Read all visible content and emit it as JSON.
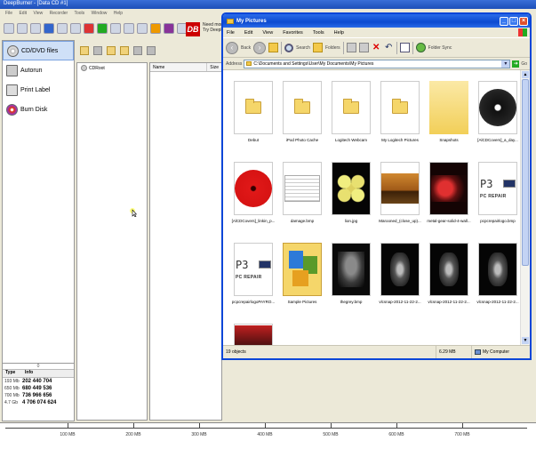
{
  "app": {
    "title": "DeepBurner - [Data CD #1]",
    "menu": [
      "File",
      "Edit",
      "View",
      "Recorder",
      "Tools",
      "Window",
      "Help"
    ],
    "promo_line1": "Need more",
    "promo_line2": "Try DeepB",
    "tasks": [
      {
        "label": "CD/DVD files",
        "icon": "cd-icon"
      },
      {
        "label": "Autorun",
        "icon": "autorun-icon"
      },
      {
        "label": "Print Label",
        "icon": "print-label-icon"
      },
      {
        "label": "Burn Disk",
        "icon": "burn-disk-icon"
      }
    ],
    "info": {
      "count": "0",
      "col_type": "Type",
      "col_info": "Info",
      "rows": [
        {
          "type": "193 Mb",
          "info": "202 440 704"
        },
        {
          "type": "650 Mb",
          "info": "680 449 536"
        },
        {
          "type": "700 Mb",
          "info": "736 966 656"
        },
        {
          "type": "4.7 Gb",
          "info": "4 706 074 624"
        }
      ]
    },
    "tree_root": "CDRoot",
    "list_cols": [
      "Name",
      "Size"
    ],
    "capacity_ticks": [
      "100 MB",
      "200 MB",
      "300 MB",
      "400 MB",
      "500 MB",
      "600 MB",
      "700 MB"
    ]
  },
  "explorer": {
    "title": "My Pictures",
    "menu": [
      "File",
      "Edit",
      "View",
      "Favorites",
      "Tools",
      "Help"
    ],
    "toolbar": {
      "back": "Back",
      "search": "Search",
      "folders": "Folders",
      "folder_sync": "Folder Sync"
    },
    "address_label": "Address",
    "address": "C:\\Documents and Settings\\User\\My Documents\\My Pictures",
    "go": "Go",
    "items": [
      {
        "name": "Debut",
        "kind": "folder"
      },
      {
        "name": "iPod Photo Cache",
        "kind": "folder"
      },
      {
        "name": "Logitech Webcam",
        "kind": "folder"
      },
      {
        "name": "My Logitech Pictures",
        "kind": "folder"
      },
      {
        "name": "Snapshots",
        "kind": "folder-open"
      },
      {
        "name": "[AlCDCovers]_a_day...",
        "kind": "image-disc"
      },
      {
        "name": "[AlCDCovers]_linkin_p...",
        "kind": "image-red"
      },
      {
        "name": "damage.bmp",
        "kind": "image-doc"
      },
      {
        "name": "lion.jpg",
        "kind": "image-lemons"
      },
      {
        "name": "Marooned_(close_up)...",
        "kind": "image-sunset"
      },
      {
        "name": "metal-gear-solid-4-wall...",
        "kind": "image-dark-red"
      },
      {
        "name": "pcpcrepairlogo.bmp",
        "kind": "image-pcrepair"
      },
      {
        "name": "pcpcrepairlogoPAYRO...",
        "kind": "image-pcrepair"
      },
      {
        "name": "Sample Pictures",
        "kind": "folder-pictures"
      },
      {
        "name": "thegrey.bmp",
        "kind": "image-face"
      },
      {
        "name": "vlcsnap-2012-11-22-2...",
        "kind": "image-vlc"
      },
      {
        "name": "vlcsnap-2012-11-22-2...",
        "kind": "image-vlc"
      },
      {
        "name": "vlcsnap-2012-11-22-2...",
        "kind": "image-vlc"
      },
      {
        "name": "",
        "kind": "image-partial"
      }
    ],
    "pc_repair_text": "PC REPAIR",
    "pc_repair_mark": "P3",
    "status": {
      "objects": "19 objects",
      "size": "6.29 MB",
      "location": "My Computer"
    }
  },
  "colors": {
    "xp_blue": "#0a46d8",
    "folder_yellow": "#f5d66a"
  }
}
